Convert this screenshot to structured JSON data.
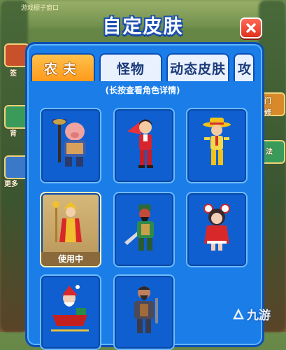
{
  "dialog": {
    "title": "自定皮肤",
    "hint": "(长按查看角色详情)"
  },
  "tabs": [
    {
      "label": "农夫",
      "active": true
    },
    {
      "label": "怪物",
      "active": false
    },
    {
      "label": "动态皮肤",
      "active": false
    },
    {
      "label": "攻",
      "active": false
    }
  ],
  "skins": [
    {
      "id": "farmer-pig",
      "in_use": false
    },
    {
      "id": "red-suit",
      "in_use": false
    },
    {
      "id": "yellow-hat",
      "in_use": false
    },
    {
      "id": "monk",
      "in_use": true,
      "status_label": "使用中"
    },
    {
      "id": "general",
      "in_use": false
    },
    {
      "id": "red-hood-girl",
      "in_use": false
    },
    {
      "id": "santa-sleigh",
      "in_use": false
    },
    {
      "id": "warrior",
      "in_use": false
    }
  ],
  "background": {
    "side_labels": [
      "签",
      "背",
      "更多",
      "门",
      "修",
      "法"
    ],
    "top_text": "游戏橱子窗口"
  },
  "watermark": {
    "text": "九游"
  },
  "colors": {
    "panel": "#1a7de8",
    "tab_active": "#ff9a1c",
    "close": "#e0321f"
  }
}
